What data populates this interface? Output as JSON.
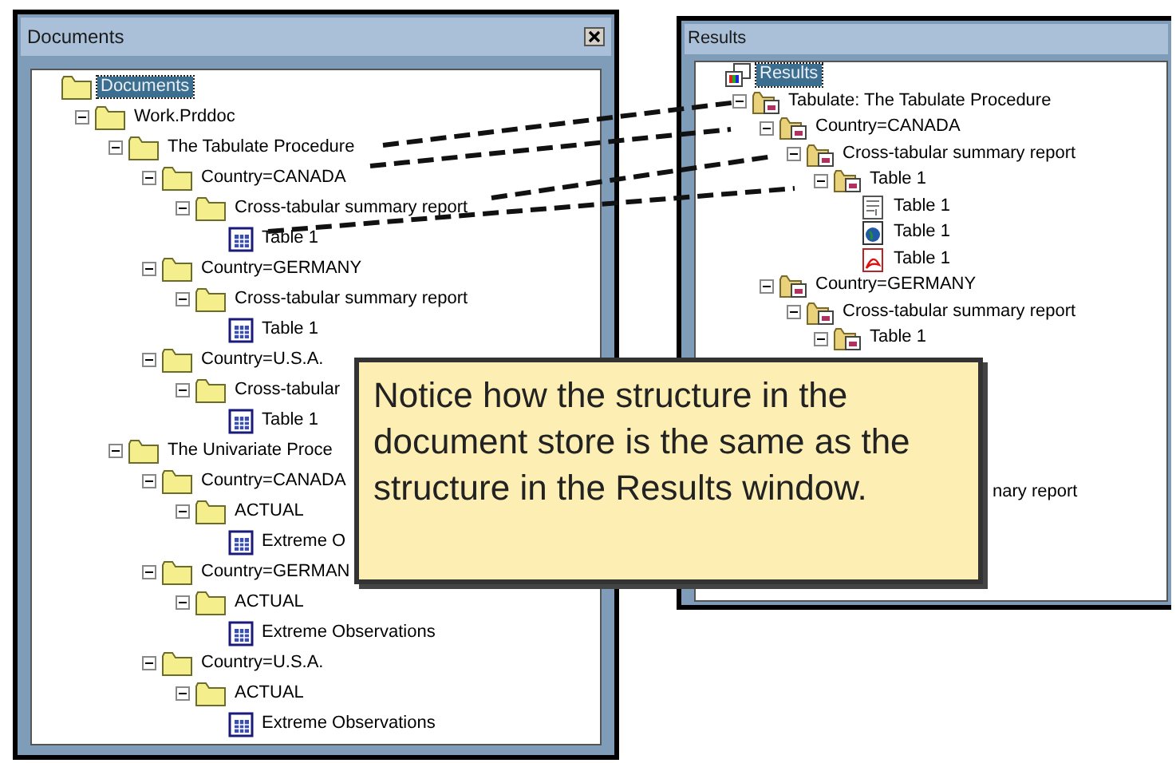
{
  "documents_window": {
    "title": "Documents",
    "tree": [
      {
        "label": "Documents",
        "kind": "folder",
        "selected": true,
        "children": [
          {
            "label": "Work.Prddoc",
            "kind": "folder",
            "selected": false,
            "expanded": true,
            "children": [
              {
                "label": "The Tabulate Procedure",
                "kind": "folder",
                "selected": false,
                "expanded": true,
                "children": [
                  {
                    "label": "Country=CANADA",
                    "kind": "folder",
                    "selected": false,
                    "expanded": true,
                    "children": [
                      {
                        "label": "Cross-tabular summary report",
                        "kind": "folder",
                        "selected": false,
                        "expanded": true,
                        "children": [
                          {
                            "label": "Table 1",
                            "kind": "table",
                            "selected": false
                          }
                        ]
                      }
                    ]
                  },
                  {
                    "label": "Country=GERMANY",
                    "kind": "folder",
                    "selected": false,
                    "expanded": true,
                    "children": [
                      {
                        "label": "Cross-tabular summary report",
                        "kind": "folder",
                        "selected": false,
                        "expanded": true,
                        "children": [
                          {
                            "label": "Table 1",
                            "kind": "table",
                            "selected": false
                          }
                        ]
                      }
                    ]
                  },
                  {
                    "label": "Country=U.S.A.",
                    "kind": "folder",
                    "selected": false,
                    "expanded": true,
                    "children": [
                      {
                        "label": "Cross-tabular",
                        "kind": "folder",
                        "selected": false,
                        "expanded": true,
                        "children": [
                          {
                            "label": "Table 1",
                            "kind": "table",
                            "selected": false
                          }
                        ]
                      }
                    ]
                  }
                ]
              },
              {
                "label": "The Univariate Proce",
                "kind": "folder",
                "selected": false,
                "expanded": true,
                "children": [
                  {
                    "label": "Country=CANADA",
                    "kind": "folder",
                    "selected": false,
                    "expanded": true,
                    "children": [
                      {
                        "label": "ACTUAL",
                        "kind": "folder",
                        "selected": false,
                        "expanded": true,
                        "children": [
                          {
                            "label": "Extreme O",
                            "kind": "table",
                            "selected": false
                          }
                        ]
                      }
                    ]
                  },
                  {
                    "label": "Country=GERMAN",
                    "kind": "folder",
                    "selected": false,
                    "expanded": true,
                    "children": [
                      {
                        "label": "ACTUAL",
                        "kind": "folder",
                        "selected": false,
                        "expanded": true,
                        "children": [
                          {
                            "label": "Extreme Observations",
                            "kind": "table",
                            "selected": false
                          }
                        ]
                      }
                    ]
                  },
                  {
                    "label": "Country=U.S.A.",
                    "kind": "folder",
                    "selected": false,
                    "expanded": true,
                    "children": [
                      {
                        "label": "ACTUAL",
                        "kind": "folder",
                        "selected": false,
                        "expanded": true,
                        "children": [
                          {
                            "label": "Extreme Observations",
                            "kind": "table",
                            "selected": false
                          }
                        ]
                      }
                    ]
                  }
                ]
              }
            ]
          }
        ]
      }
    ]
  },
  "results_window": {
    "title": "Results",
    "tree": [
      {
        "label": "Results",
        "kind": "results",
        "selected": true,
        "children": [
          {
            "label": "Tabulate:  The Tabulate Procedure",
            "kind": "result-folder",
            "selected": false,
            "expanded": true,
            "children": [
              {
                "label": "Country=CANADA",
                "kind": "result-folder",
                "selected": false,
                "expanded": true,
                "children": [
                  {
                    "label": "Cross-tabular summary report",
                    "kind": "result-folder",
                    "selected": false,
                    "expanded": true,
                    "children": [
                      {
                        "label": "Table 1",
                        "kind": "result-folder",
                        "selected": false,
                        "expanded": true,
                        "children": [
                          {
                            "label": "Table 1",
                            "kind": "listing",
                            "selected": false
                          },
                          {
                            "label": "Table 1",
                            "kind": "html",
                            "selected": false
                          },
                          {
                            "label": "Table 1",
                            "kind": "pdf",
                            "selected": false
                          }
                        ]
                      }
                    ]
                  }
                ]
              },
              {
                "label": "Country=GERMANY",
                "kind": "result-folder",
                "selected": false,
                "expanded": true,
                "children": [
                  {
                    "label": "Cross-tabular summary report",
                    "kind": "result-folder",
                    "selected": false,
                    "expanded": true,
                    "children": [
                      {
                        "label": "Table 1",
                        "kind": "result-folder",
                        "selected": false,
                        "expanded": true
                      }
                    ]
                  }
                ]
              }
            ]
          }
        ]
      }
    ],
    "partial_label": "nary report"
  },
  "callout": {
    "text": "Notice how the structure in the document store is the same as the structure in the Results window."
  }
}
